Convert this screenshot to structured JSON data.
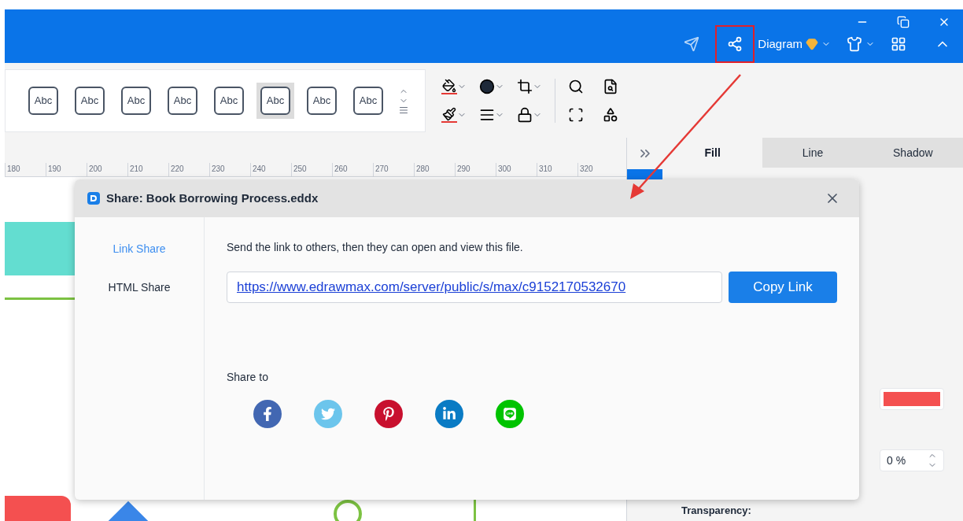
{
  "titlebar": {
    "diagram_menu": "Diagram"
  },
  "toolbar": {
    "style_presets": [
      {
        "label": "Abc",
        "selected": false
      },
      {
        "label": "Abc",
        "selected": false
      },
      {
        "label": "Abc",
        "selected": false
      },
      {
        "label": "Abc",
        "selected": false
      },
      {
        "label": "Abc",
        "selected": false
      },
      {
        "label": "Abc",
        "selected": true
      },
      {
        "label": "Abc",
        "selected": false
      },
      {
        "label": "Abc",
        "selected": false
      }
    ]
  },
  "ruler": {
    "ticks": [
      "180",
      "190",
      "200",
      "210",
      "220",
      "230",
      "240",
      "250",
      "260",
      "270",
      "280",
      "290",
      "300",
      "310",
      "320"
    ]
  },
  "right_panel": {
    "tabs": [
      {
        "label": "Fill",
        "selected": true
      },
      {
        "label": "Line",
        "selected": false
      },
      {
        "label": "Shadow",
        "selected": false
      }
    ],
    "transparency_value": "0 %",
    "transparency_label": "Transparency:"
  },
  "dialog": {
    "title": "Share: Book Borrowing Process.eddx",
    "tabs": [
      {
        "label": "Link Share",
        "selected": true
      },
      {
        "label": "HTML Share",
        "selected": false
      }
    ],
    "description": "Send the link to others, then they can open and view this file.",
    "link": "https://www.edrawmax.com/server/public/s/max/c9152170532670",
    "copy_button": "Copy Link",
    "share_label": "Share to"
  }
}
